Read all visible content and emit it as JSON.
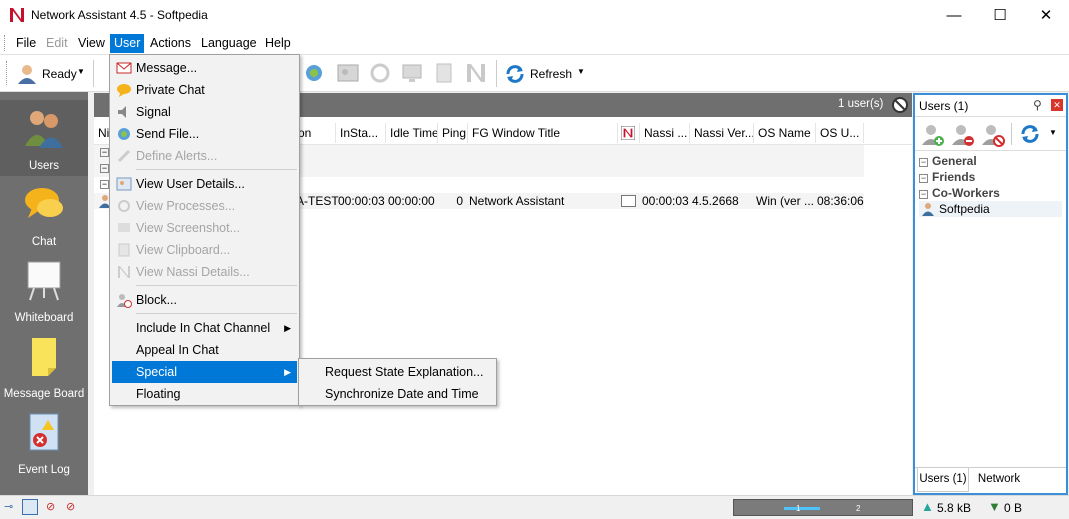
{
  "window": {
    "title": "Network Assistant 4.5 - Softpedia",
    "minimize": "—",
    "maximize": "☐",
    "close": "✕"
  },
  "menubar": {
    "items": [
      {
        "label": "File"
      },
      {
        "label": "Edit"
      },
      {
        "label": "View"
      },
      {
        "label": "User"
      },
      {
        "label": "Actions"
      },
      {
        "label": "Language"
      },
      {
        "label": "Help"
      }
    ]
  },
  "toolbar": {
    "status_label": "Ready",
    "refresh_label": "Refresh"
  },
  "leftnav": {
    "items": [
      {
        "label": "Users"
      },
      {
        "label": "Chat"
      },
      {
        "label": "Whiteboard"
      },
      {
        "label": "Message Board"
      },
      {
        "label": "Event Log"
      }
    ]
  },
  "main": {
    "user_count": "1 user(s)",
    "columns": [
      "Ni",
      "on",
      "InSta...",
      "Idle Time",
      "Ping",
      "FG Window Title",
      "",
      "Nassi ...",
      "Nassi Ver...",
      "OS Name",
      "OS U..."
    ],
    "row": {
      "name_partial": "A-TEST",
      "instate": "00:00:03",
      "idle": "00:00:00",
      "ping": "0",
      "fg_window": "Network Assistant",
      "nassi": "00:00:03",
      "nassi_ver": "4.5.2668",
      "os_name": "Win (ver ...",
      "os_uptime": "08:36:06"
    }
  },
  "user_menu": {
    "items": [
      {
        "label": "Message...",
        "icon": "message-icon"
      },
      {
        "label": "Private Chat",
        "icon": "private-chat-icon"
      },
      {
        "label": "Signal",
        "icon": "speaker-icon"
      },
      {
        "label": "Send File...",
        "icon": "send-file-icon"
      },
      {
        "label": "Define Alerts...",
        "icon": "alert-icon"
      },
      {
        "label": "View User Details...",
        "icon": "user-details-icon"
      },
      {
        "label": "View Processes...",
        "icon": "processes-icon"
      },
      {
        "label": "View Screenshot...",
        "icon": "screenshot-icon"
      },
      {
        "label": "View Clipboard...",
        "icon": "clipboard-icon"
      },
      {
        "label": "View Nassi Details...",
        "icon": "nassi-icon"
      },
      {
        "label": "Block...",
        "icon": "block-icon"
      },
      {
        "label": "Include In Chat Channel"
      },
      {
        "label": "Appeal In Chat"
      },
      {
        "label": "Special"
      },
      {
        "label": "Floating"
      }
    ]
  },
  "special_menu": {
    "items": [
      {
        "label": "Request State Explanation..."
      },
      {
        "label": "Synchronize Date and Time"
      }
    ]
  },
  "rightpanel": {
    "title": "Users (1)",
    "groups": [
      "General",
      "Friends",
      "Co-Workers"
    ],
    "user": "Softpedia",
    "tabs": [
      "Users (1)",
      "Network"
    ]
  },
  "statusbar": {
    "upload": "5.8 kB",
    "download": "0 B",
    "meter_ticks": [
      "1",
      "2"
    ]
  },
  "colors": {
    "accent": "#0078d7",
    "nav_bg": "#6f6f6f",
    "panel_border": "#3a8fd8"
  }
}
